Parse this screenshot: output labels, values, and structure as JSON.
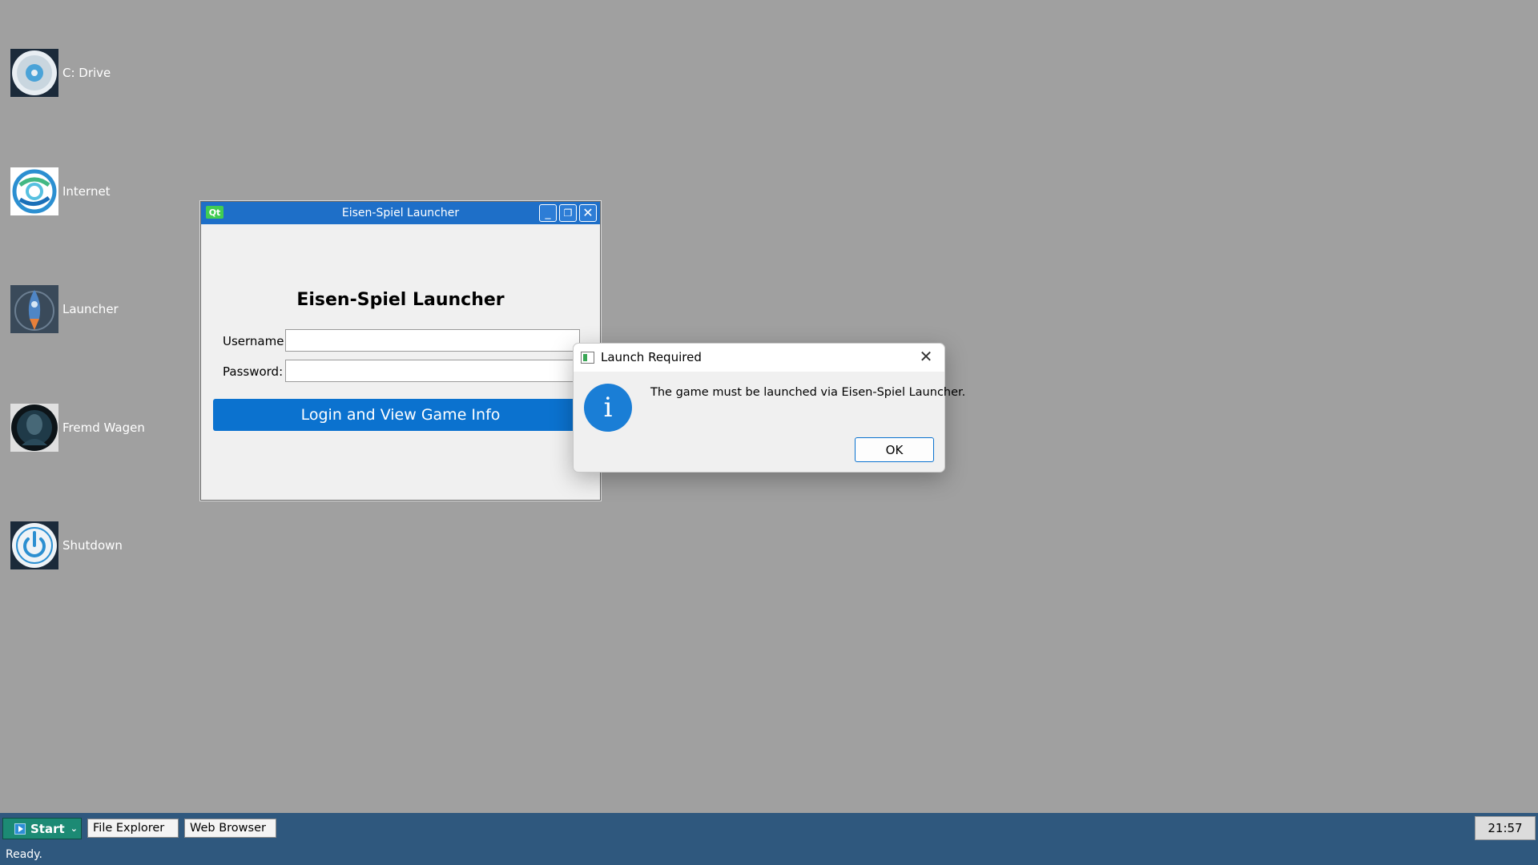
{
  "desktop": {
    "icons": [
      {
        "label": "C: Drive",
        "icon": "drive-icon"
      },
      {
        "label": "Internet",
        "icon": "internet-icon"
      },
      {
        "label": "Launcher",
        "icon": "rocket-icon"
      },
      {
        "label": "Fremd Wagen",
        "icon": "game-icon"
      },
      {
        "label": "Shutdown",
        "icon": "power-icon"
      }
    ]
  },
  "launcher_window": {
    "title": "Eisen-Spiel Launcher",
    "qt_badge": "Qt",
    "minimize_glyph": "_",
    "maximize_glyph": "❐",
    "close_glyph": "✕",
    "heading": "Eisen-Spiel Launcher",
    "username_label": "Username:",
    "username_value": "",
    "password_label": "Password:",
    "password_value": "",
    "login_button": "Login and View Game Info"
  },
  "dialog": {
    "title": "Launch Required",
    "close_glyph": "✕",
    "info_glyph": "i",
    "message": "The game must be launched via Eisen-Spiel Launcher.",
    "ok_button": "OK"
  },
  "taskbar": {
    "start_label": "Start",
    "start_arrow": "⌄",
    "tasks": [
      "File Explorer",
      "Web Browser"
    ],
    "clock": "21:57"
  },
  "statusbar": {
    "text": "Ready."
  },
  "colors": {
    "desktop_bg": "#a0a0a0",
    "titlebar": "#1e6fc8",
    "accent": "#0b72cf",
    "taskbar": "#2f587e",
    "start_button": "#1c8a74"
  }
}
